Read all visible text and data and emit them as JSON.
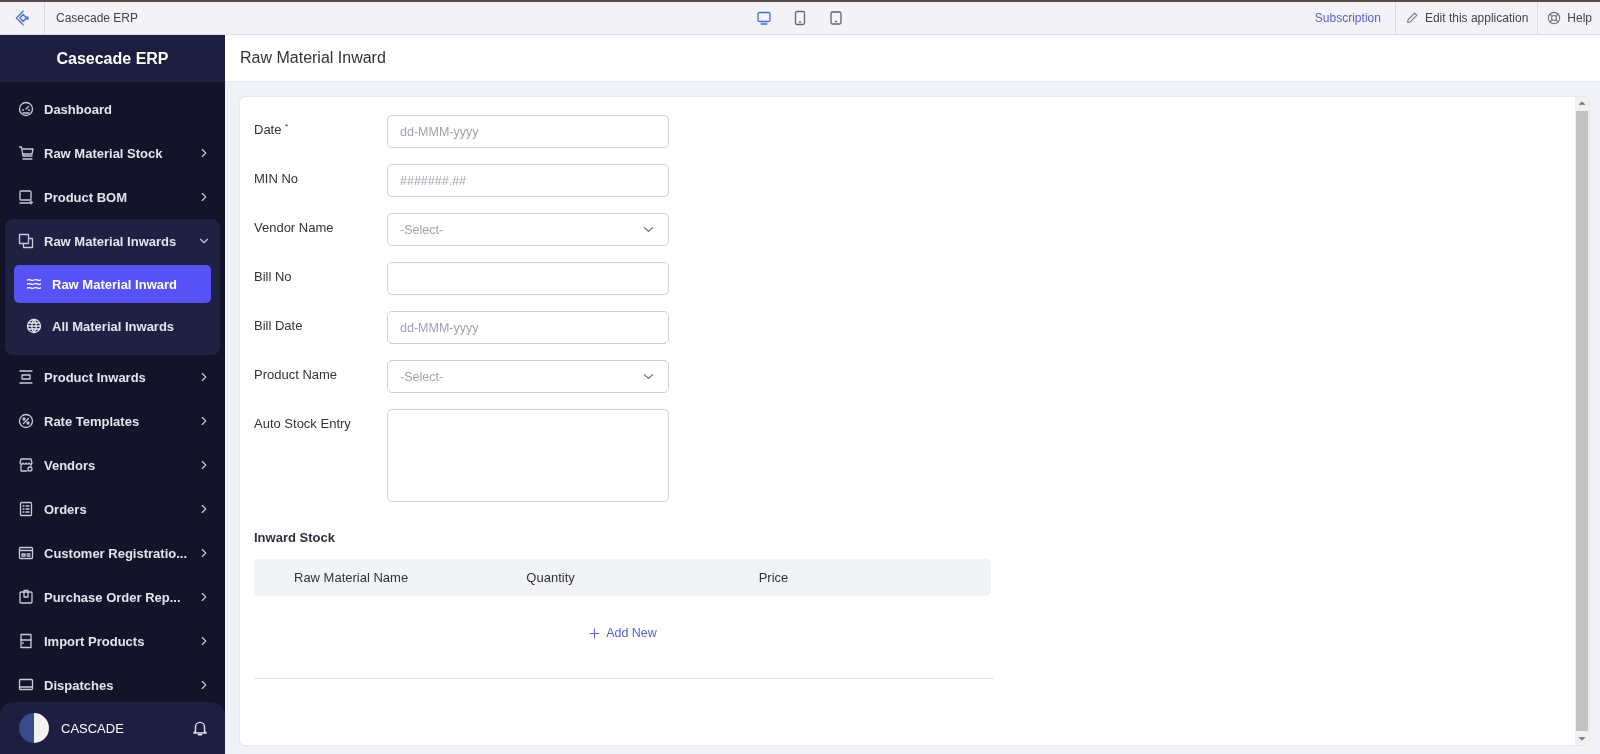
{
  "topbar": {
    "app_title": "Casecade ERP",
    "devices": [
      {
        "kind": "desktop",
        "selected": true
      },
      {
        "kind": "tablet",
        "selected": false
      },
      {
        "kind": "mobile",
        "selected": false
      }
    ],
    "subscription": "Subscription",
    "edit": "Edit this application",
    "help": "Help"
  },
  "sidebar": {
    "title": "Casecade ERP",
    "items": [
      {
        "label": "Dashboard",
        "kind": "link"
      },
      {
        "label": "Raw Material Stock",
        "kind": "group",
        "expanded": false
      },
      {
        "label": "Product BOM",
        "kind": "group",
        "expanded": false
      },
      {
        "label": "Raw Material Inwards",
        "kind": "group",
        "expanded": true,
        "children": [
          {
            "label": "Raw Material Inward",
            "selected": true
          },
          {
            "label": "All Material Inwards",
            "selected": false
          }
        ]
      },
      {
        "label": "Product Inwards",
        "kind": "group",
        "expanded": false
      },
      {
        "label": "Rate Templates",
        "kind": "group",
        "expanded": false
      },
      {
        "label": "Vendors",
        "kind": "group",
        "expanded": false
      },
      {
        "label": "Orders",
        "kind": "group",
        "expanded": false
      },
      {
        "label": "Customer Registratio...",
        "kind": "group",
        "expanded": false
      },
      {
        "label": "Purchase Order Rep...",
        "kind": "group",
        "expanded": false
      },
      {
        "label": "Import Products",
        "kind": "group",
        "expanded": false
      },
      {
        "label": "Dispatches",
        "kind": "group",
        "expanded": false
      }
    ],
    "user": "CASCADE"
  },
  "page": {
    "title": "Raw Material Inward",
    "fields": [
      {
        "label": "Date $^{*}$",
        "kind": "date",
        "placeholder": "dd-MMM-yyyy"
      },
      {
        "label": "MIN No",
        "kind": "text",
        "placeholder": "#######.##"
      },
      {
        "label": "Vendor Name",
        "kind": "select",
        "placeholder": "-Select-"
      },
      {
        "label": "Bill No",
        "kind": "text"
      },
      {
        "label": "Bill Date",
        "kind": "date",
        "placeholder": "dd-MMM-yyyy"
      },
      {
        "label": "Product Name",
        "kind": "select",
        "placeholder": "-Select-"
      },
      {
        "label": "Auto Stock Entry",
        "kind": "textarea"
      }
    ],
    "subform": {
      "title": "Inward Stock",
      "columns": [
        "Raw Material Name",
        "Quantity",
        "Price"
      ],
      "add": "Add New"
    }
  }
}
